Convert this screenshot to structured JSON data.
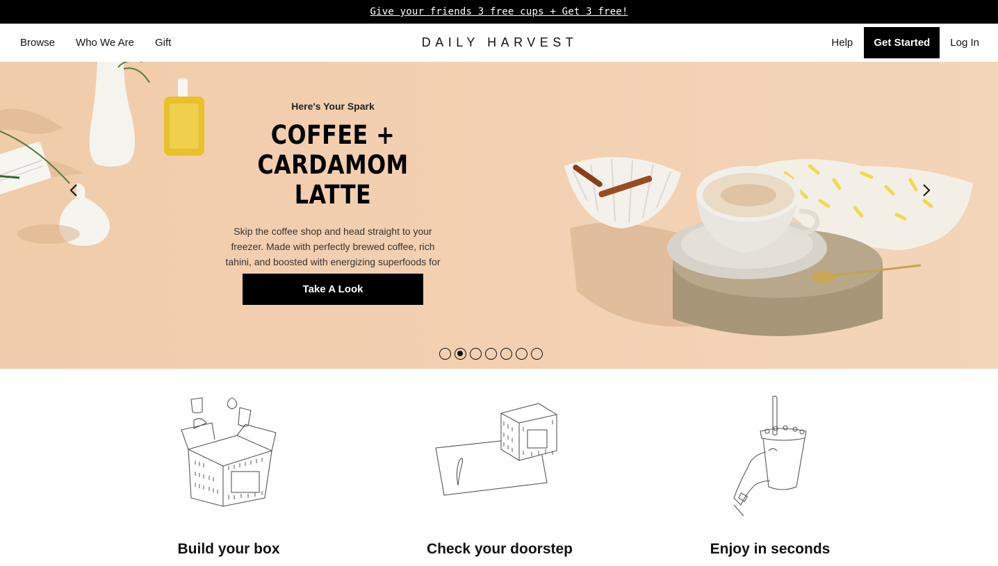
{
  "promo": {
    "text": "Give your friends 3 free cups + Get 3 free!"
  },
  "header": {
    "nav_left": [
      "Browse",
      "Who We Are",
      "Gift"
    ],
    "logo": "DAILY HARVEST",
    "help": "Help",
    "get_started": "Get Started",
    "login": "Log In"
  },
  "hero": {
    "eyebrow": "Here's Your Spark",
    "title": "COFFEE + CARDAMOM LATTE",
    "description": "Skip the coffee shop and head straight to your freezer. Made with perfectly brewed coffee, rich tahini, and boosted with energizing superfoods for laser-sharp focus.",
    "button": "Take A Look",
    "slide_count": 7,
    "active_slide": 2
  },
  "steps": [
    {
      "title": "Build your box",
      "icon": "box-icon"
    },
    {
      "title": "Check your doorstep",
      "icon": "doorstep-icon"
    },
    {
      "title": "Enjoy in seconds",
      "icon": "cup-in-hand-icon"
    }
  ],
  "colors": {
    "accent": "#000000",
    "hero_bg": "#f3d0b1"
  }
}
